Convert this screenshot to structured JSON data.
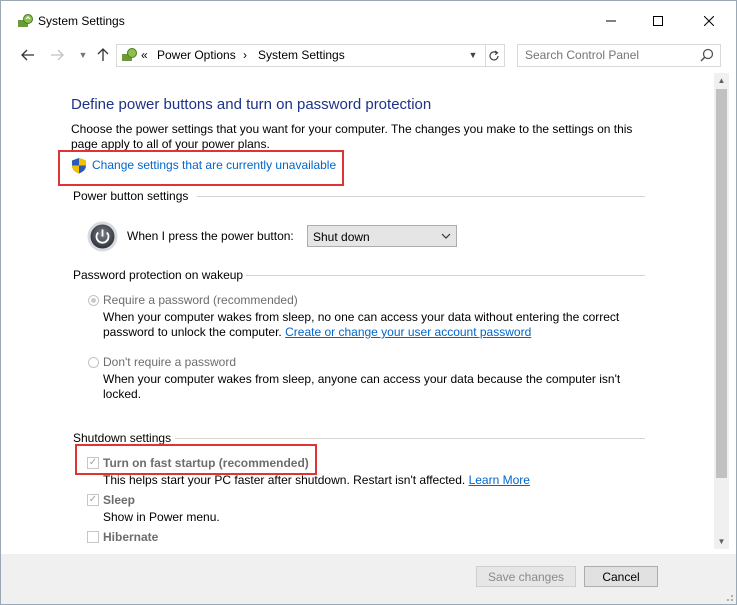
{
  "window": {
    "title": "System Settings"
  },
  "address": {
    "prefix": "«",
    "crumbs": [
      "Power Options",
      "System Settings"
    ],
    "separator": "›"
  },
  "search": {
    "placeholder": "Search Control Panel"
  },
  "main": {
    "heading": "Define power buttons and turn on password protection",
    "description": "Choose the power settings that you want for your computer. The changes you make to the settings on this page apply to all of your power plans.",
    "change_link": "Change settings that are currently unavailable",
    "power_section": {
      "title": "Power button settings",
      "label": "When I press the power button:",
      "selected": "Shut down"
    },
    "password_section": {
      "title": "Password protection on wakeup",
      "require_label": "Require a password (recommended)",
      "require_desc": "When your computer wakes from sleep, no one can access your data without entering the correct password to unlock the computer.",
      "require_link": "Create or change your user account password",
      "require_selected": true,
      "dont_label": "Don't require a password",
      "dont_desc": "When your computer wakes from sleep, anyone can access your data because the computer isn't locked."
    },
    "shutdown_section": {
      "title": "Shutdown settings",
      "fast_startup_label": "Turn on fast startup (recommended)",
      "fast_startup_checked": true,
      "fast_startup_desc": "This helps start your PC faster after shutdown. Restart isn't affected.",
      "learn_more": "Learn More",
      "sleep_label": "Sleep",
      "sleep_checked": true,
      "sleep_desc": "Show in Power menu.",
      "hibernate_label": "Hibernate",
      "hibernate_checked": false
    }
  },
  "footer": {
    "save_label": "Save changes",
    "cancel_label": "Cancel"
  },
  "colors": {
    "heading": "#1e3287",
    "link": "#0066cc",
    "highlight": "#e03434"
  }
}
